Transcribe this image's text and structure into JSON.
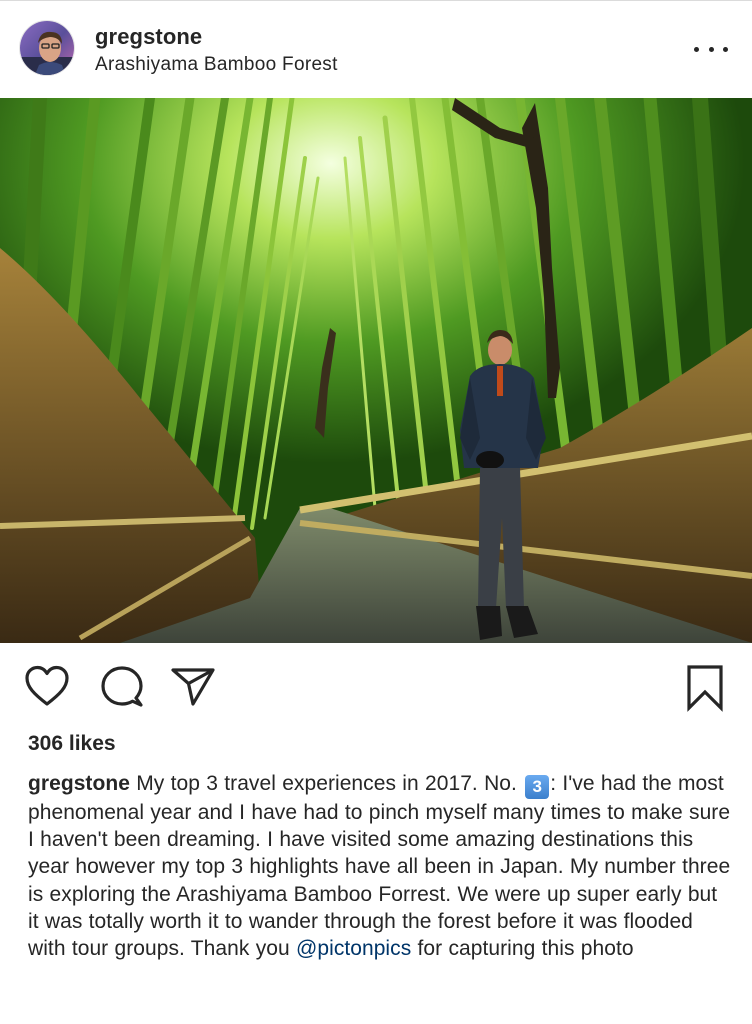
{
  "post": {
    "username": "gregstone",
    "location": "Arashiyama Bamboo Forest"
  },
  "icons": {
    "more": "more-options-icon",
    "like": "heart-icon",
    "comment": "comment-bubble-icon",
    "share": "paper-plane-icon",
    "save": "bookmark-icon"
  },
  "likes": "306 likes",
  "caption": {
    "username": "gregstone",
    "text_before_emoji": " My top 3 travel experiences in 2017. No. ",
    "emoji": "3",
    "text_after_emoji": ": I've had the most phenomenal year and I have had to pinch myself many times to make sure I haven't been dreaming. I have visited some amazing destinations this year however my top 3 highlights have all been in Japan. My number three is exploring the Arashiyama  Bamboo Forrest. We were up super early but it was totally worth it to wander through the forest before it was flooded with tour groups. Thank you ",
    "mention": "@pictonpics",
    "text_end": " for capturing this photo"
  },
  "colors": {
    "text": "#262626",
    "mention": "#003569",
    "divider": "#dbdbdb"
  }
}
